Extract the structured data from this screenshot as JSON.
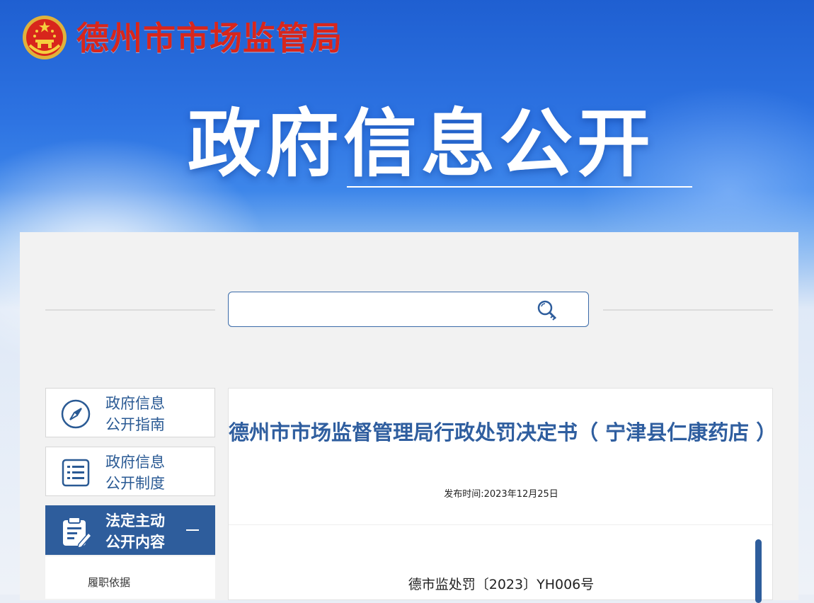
{
  "site": {
    "name": "德州市市场监管局",
    "hero_title": "政府信息公开"
  },
  "search": {
    "value": "",
    "placeholder": ""
  },
  "nav": {
    "items": [
      {
        "line1": "政府信息",
        "line2": "公开指南",
        "icon": "compass-icon"
      },
      {
        "line1": "政府信息",
        "line2": "公开制度",
        "icon": "document-list-icon"
      },
      {
        "line1": "法定主动",
        "line2": "公开内容",
        "icon": "clipboard-edit-icon",
        "active": true
      }
    ],
    "sub_items": [
      "履职依据"
    ]
  },
  "article": {
    "title": "德州市市场监督管理局行政处罚决定书（ 宁津县仁康药店 ）",
    "publish_label": "发布时间:",
    "publish_date": "2023年12月25日",
    "doc_number": "德市监处罚〔2023〕YH006号"
  },
  "colors": {
    "brand_red": "#d8261c",
    "primary_blue": "#2e5d9c",
    "title_blue": "#2f5e9f"
  }
}
